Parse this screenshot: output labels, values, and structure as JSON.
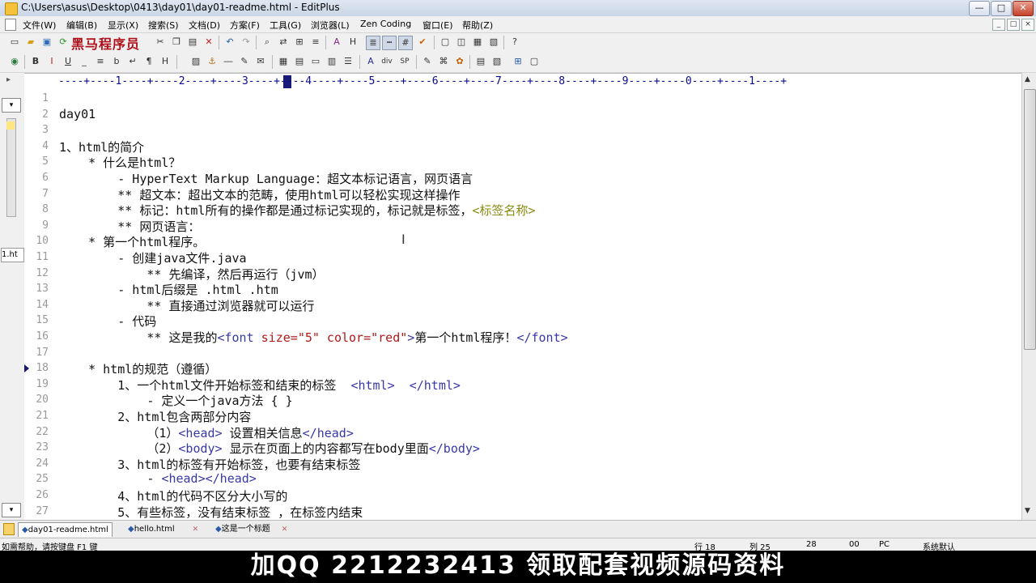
{
  "window": {
    "title": "C:\\Users\\asus\\Desktop\\0413\\day01\\day01-readme.html - EditPlus",
    "minimize": "—",
    "maximize": "□",
    "close": "✕"
  },
  "menu": {
    "items": [
      "文件(W)",
      "编辑(B)",
      "显示(X)",
      "搜索(S)",
      "文档(D)",
      "方案(F)",
      "工具(G)",
      "浏览器(L)",
      "Zen Coding",
      "窗口(E)",
      "帮助(Z)"
    ],
    "mdi_controls": [
      "_",
      "□",
      "×"
    ]
  },
  "watermark": "黑马程序员",
  "ruler": "----+----1----+----2----+----3----+----4----+----5----+----6----+----7----+----8----+----9----+----0----+----1----+",
  "editor": {
    "current_line": 18,
    "lines": [
      {
        "n": "1",
        "text": ""
      },
      {
        "n": "2",
        "text": "day01"
      },
      {
        "n": "3",
        "text": ""
      },
      {
        "n": "4",
        "text": "1、html的简介"
      },
      {
        "n": "5",
        "text": "    * 什么是html？"
      },
      {
        "n": "6",
        "text": "        - HyperText Markup Language：超文本标记语言，网页语言"
      },
      {
        "n": "7",
        "text": "        ** 超文本：超出文本的范畴，使用html可以轻松实现这样操作"
      },
      {
        "n": "8",
        "text": "        ** 标记：html所有的操作都是通过标记实现的，标记就是标签，",
        "tail_label": "<标签名称>"
      },
      {
        "n": "9",
        "text": "        ** 网页语言："
      },
      {
        "n": "10",
        "text": "    * 第一个html程序。"
      },
      {
        "n": "11",
        "text": "        - 创建java文件.java"
      },
      {
        "n": "12",
        "text": "            ** 先编译，然后再运行（jvm）"
      },
      {
        "n": "13",
        "text": "        - html后缀是 .html .htm"
      },
      {
        "n": "14",
        "text": "            ** 直接通过浏览器就可以运行"
      },
      {
        "n": "15",
        "text": "        - 代码"
      },
      {
        "n": "16",
        "text": "            ** 这是我的",
        "font_open": "<font ",
        "attr1": "size=",
        "val1": "\"5\"",
        "attr2": " color=",
        "val2": "\"red\"",
        "close_br": ">",
        "inner": "第一个html程序！",
        "font_close": "</font>"
      },
      {
        "n": "17",
        "text": ""
      },
      {
        "n": "18",
        "text": "    * html的规范（遵循）"
      },
      {
        "n": "19",
        "text": "        1、一个html文件开始标签和结束的标签  ",
        "tag_a": "<html>",
        "gap": "  ",
        "tag_b": "</html>"
      },
      {
        "n": "20",
        "text": "            - 定义一个java方法 { }"
      },
      {
        "n": "21",
        "text": "        2、html包含两部分内容"
      },
      {
        "n": "22",
        "text": "            （1）",
        "tag_a": "<head>",
        "mid": " 设置相关信息",
        "tag_b": "</head>"
      },
      {
        "n": "23",
        "text": "            （2）",
        "tag_a": "<body>",
        "mid": " 显示在页面上的内容都写在body里面",
        "tag_b": "</body>"
      },
      {
        "n": "24",
        "text": "        3、html的标签有开始标签，也要有结束标签"
      },
      {
        "n": "25",
        "text": "            - ",
        "tag_a": "<head></head>"
      },
      {
        "n": "26",
        "text": "        4、html的代码不区分大小写的"
      },
      {
        "n": "27",
        "text": "        5、有些标签，没有结束标签 ，在标签内结束"
      }
    ]
  },
  "tabs": [
    {
      "label": "day01-readme.html",
      "active": true
    },
    {
      "label": "hello.html",
      "active": false
    },
    {
      "label": "这是一个标题",
      "active": false
    }
  ],
  "left_panel_label": "1.ht",
  "status": {
    "help": "如需帮助，请按键盘 F1 键",
    "line": "行 18",
    "col": "列 25",
    "num": "28",
    "sel": "00",
    "eol": "PC",
    "encoding": "系统默认"
  },
  "banner": "加QQ 2212232413  领取配套视频源码资料",
  "colors": {
    "tag": "#3838a8",
    "attr": "#b01818",
    "label": "#8a8a10",
    "banner_bg": "#000000"
  }
}
